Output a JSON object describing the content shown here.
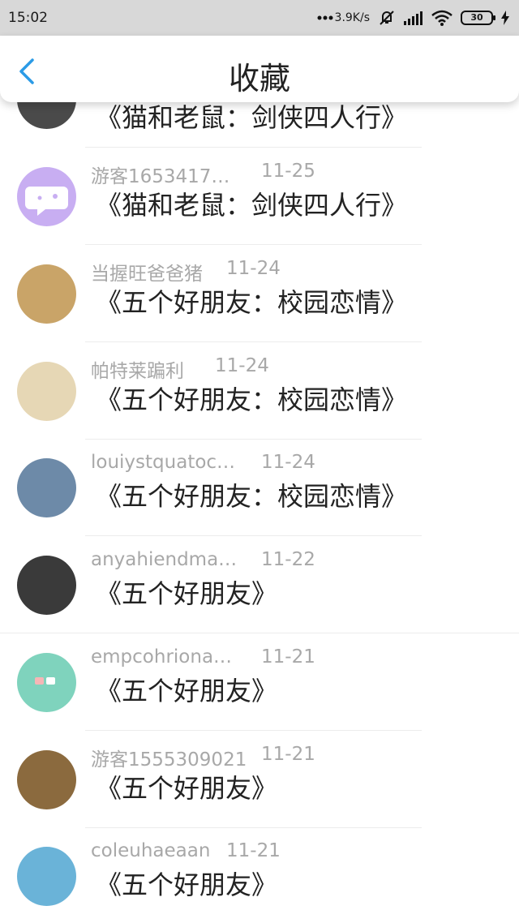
{
  "status_bar": {
    "time": "15:02",
    "network_speed": "3.9K/s",
    "battery": "30",
    "icons": [
      "signal-dots-icon",
      "mute-bell-icon",
      "cellular-signal-icon",
      "wifi-icon",
      "battery-icon",
      "charging-icon"
    ]
  },
  "nav": {
    "title": "收藏",
    "back_icon": "chevron-left-icon"
  },
  "items": [
    {
      "user": "",
      "date": "",
      "title": "《猫和老鼠：剑侠四人行》",
      "avatar_color": "#4a4a4a"
    },
    {
      "user": "游客1653417…",
      "date": "11-25",
      "title": "《猫和老鼠：剑侠四人行》",
      "avatar_color": "#c8aef2"
    },
    {
      "user": "当握旺爸爸猪",
      "date": "11-24",
      "title": "《五个好朋友：校园恋情》",
      "avatar_color": "#c9a468"
    },
    {
      "user": "帕特莱蹁利",
      "date": "11-24",
      "title": "《五个好朋友：校园恋情》",
      "avatar_color": "#e6d7b5"
    },
    {
      "user": "louiystquatoc…",
      "date": "11-24",
      "title": "《五个好朋友：校园恋情》",
      "avatar_color": "#6d8aa8"
    },
    {
      "user": "anyahiendma…",
      "date": "11-22",
      "title": "《五个好朋友》",
      "avatar_color": "#3a3a3a"
    },
    {
      "user": "empcohriona…",
      "date": "11-21",
      "title": "《五个好朋友》",
      "avatar_color": "#7fd3bd"
    },
    {
      "user": "游客1555309021",
      "date": "11-21",
      "title": "《五个好朋友》",
      "avatar_color": "#8b6a3e"
    },
    {
      "user": "coleuhaeaan",
      "date": "11-21",
      "title": "《五个好朋友》",
      "avatar_color": "#6ab3d8"
    }
  ]
}
